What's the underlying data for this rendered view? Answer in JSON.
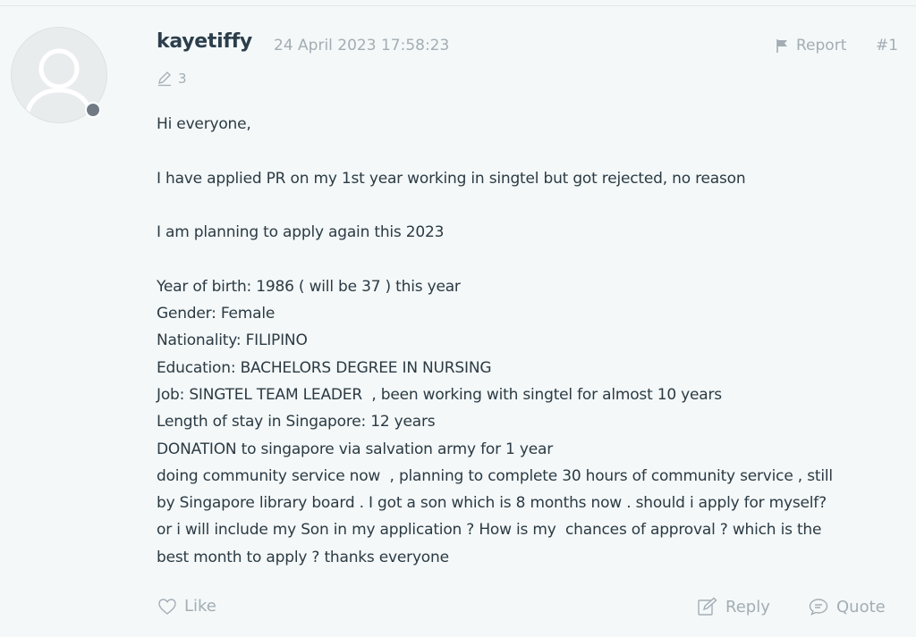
{
  "post": {
    "username": "kayetiffy",
    "timestamp": "24 April 2023 17:58:23",
    "report_label": "Report",
    "post_number": "#1",
    "edit_count": "3",
    "body_lines": [
      "Hi everyone,",
      "",
      "I have applied PR on my 1st year working in singtel but got rejected, no reason",
      "",
      "I am planning to apply again this 2023",
      "",
      "Year of birth: 1986 ( will be 37 ) this year",
      "Gender: Female",
      "Nationality: FILIPINO",
      "Education: BACHELORS DEGREE IN NURSING",
      "Job: SINGTEL TEAM LEADER  , been working with singtel for almost 10 years",
      "Length of stay in Singapore: 12 years",
      "DONATION to singapore via salvation army for 1 year",
      "doing community service now  , planning to complete 30 hours of community service , still",
      "by Singapore library board . I got a son which is 8 months now . should i apply for myself?",
      "or i will include my Son in my application ? How is my  chances of approval ? which is the",
      "best month to apply ? thanks everyone"
    ]
  },
  "actions": {
    "like_label": "Like",
    "reply_label": "Reply",
    "quote_label": "Quote"
  },
  "colors": {
    "background": "#f4f8f8",
    "text": "#2b3a44",
    "muted": "#a3adb4",
    "status_dot": "#6f7a84"
  },
  "icons": {
    "avatar": "user-silhouette-icon",
    "report": "flag-icon",
    "edit": "pencil-icon",
    "like": "heart-icon",
    "reply": "reply-edit-icon",
    "quote": "speech-bubble-icon"
  }
}
